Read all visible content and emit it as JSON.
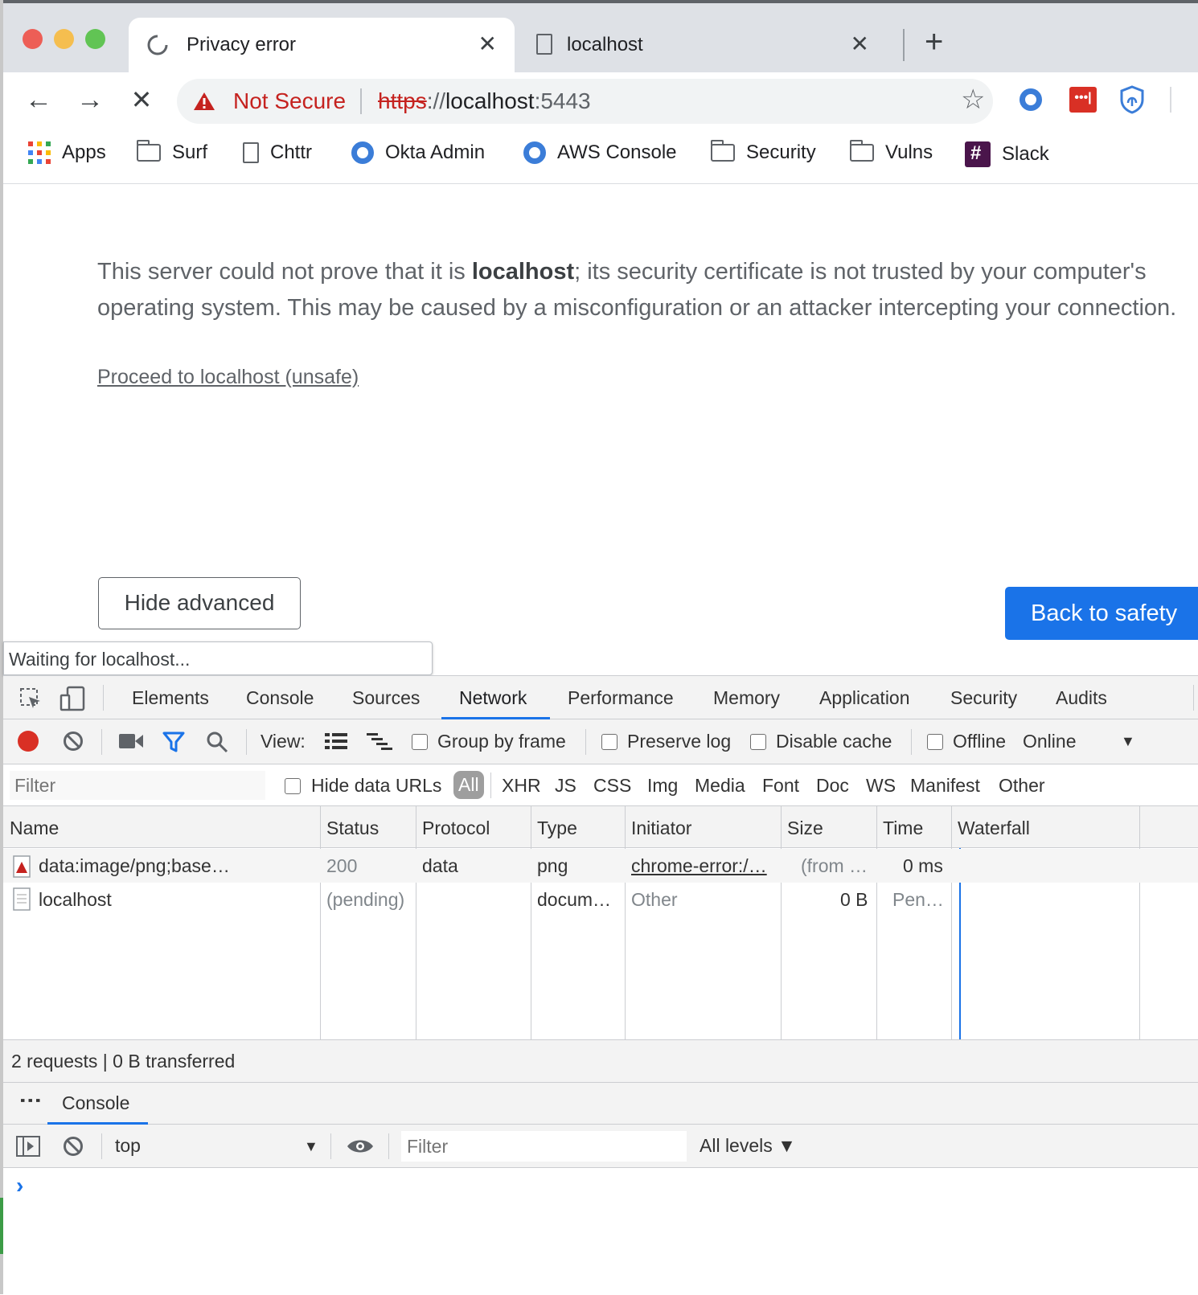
{
  "window": {
    "tabs": [
      {
        "title": "Privacy error",
        "active": true
      },
      {
        "title": "localhost",
        "active": false
      }
    ],
    "new_tab_symbol": "+",
    "tab_close_symbol": "✕"
  },
  "omnibox": {
    "security_label": "Not Secure",
    "scheme": "https",
    "sep": "://",
    "host": "localhost",
    "port": ":5443"
  },
  "bookmarks": [
    {
      "label": "Apps",
      "icon": "apps-grid-icon"
    },
    {
      "label": "Surf",
      "icon": "folder-icon"
    },
    {
      "label": "Chttr",
      "icon": "page-icon"
    },
    {
      "label": "Okta Admin",
      "icon": "okta-icon"
    },
    {
      "label": "AWS Console",
      "icon": "okta-icon"
    },
    {
      "label": "Security",
      "icon": "folder-icon"
    },
    {
      "label": "Vulns",
      "icon": "folder-icon"
    },
    {
      "label": "Slack",
      "icon": "slack-icon"
    }
  ],
  "interstitial": {
    "text_before": "This server could not prove that it is ",
    "host_bold": "localhost",
    "text_after_1": "; its security certificate is not trusted by your computer's",
    "text_line_2": "operating system. This may be caused by a misconfiguration or an attacker intercepting your connection.",
    "proceed_link": "Proceed to localhost (unsafe)",
    "hide_advanced": "Hide advanced",
    "back_to_safety": "Back to safety"
  },
  "status_bubble": "Waiting for localhost...",
  "devtools": {
    "tabs": [
      "Elements",
      "Console",
      "Sources",
      "Network",
      "Performance",
      "Memory",
      "Application",
      "Security",
      "Audits"
    ],
    "active_tab": "Network",
    "toolbar": {
      "view_label": "View:",
      "group_by_frame": "Group by frame",
      "preserve_log": "Preserve log",
      "disable_cache": "Disable cache",
      "offline": "Offline",
      "throttling": "Online"
    },
    "filter": {
      "placeholder": "Filter",
      "hide_data_urls": "Hide data URLs",
      "types": [
        "All",
        "XHR",
        "JS",
        "CSS",
        "Img",
        "Media",
        "Font",
        "Doc",
        "WS",
        "Manifest",
        "Other"
      ]
    },
    "columns": [
      "Name",
      "Status",
      "Protocol",
      "Type",
      "Initiator",
      "Size",
      "Time",
      "Waterfall"
    ],
    "rows": [
      {
        "name": "data:image/png;base…",
        "status": "200",
        "protocol": "data",
        "type": "png",
        "initiator": "chrome-error:/…",
        "size": "(from …",
        "time": "0 ms"
      },
      {
        "name": "localhost",
        "status": "(pending)",
        "protocol": "",
        "type": "docum…",
        "initiator": "Other",
        "size": "0 B",
        "time": "Pen…"
      }
    ],
    "summary": "2 requests | 0 B transferred",
    "drawer_tab": "Console",
    "console": {
      "context": "top",
      "filter_placeholder": "Filter",
      "levels": "All levels ▼",
      "prompt": "›"
    }
  },
  "colors": {
    "not_secure_red": "#c5221f",
    "link_blue": "#1a73e8",
    "devtools_accent": "#1a73e8",
    "record_red": "#d93025"
  }
}
